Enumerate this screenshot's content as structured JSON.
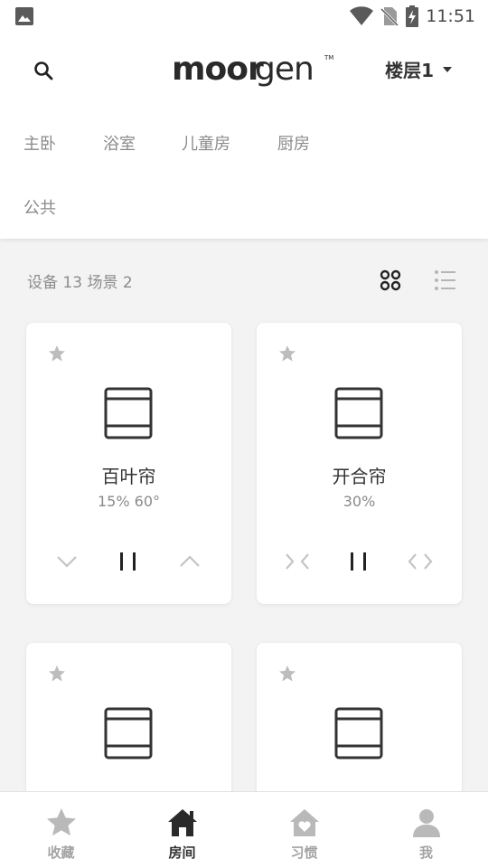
{
  "status_bar": {
    "time": "11:51"
  },
  "header": {
    "logo_text": "moorgen",
    "floor_label": "楼层1"
  },
  "rooms": [
    "主卧",
    "浴室",
    "儿童房",
    "厨房",
    "公共"
  ],
  "summary": {
    "text": "设备 13 场景 2"
  },
  "devices": [
    {
      "name": "百叶帘",
      "value": "15% 60°"
    },
    {
      "name": "开合帘",
      "value": "30%"
    },
    {
      "name": "",
      "value": ""
    },
    {
      "name": "",
      "value": ""
    }
  ],
  "nav": [
    {
      "label": "收藏",
      "icon": "star-icon"
    },
    {
      "label": "房间",
      "icon": "home-icon"
    },
    {
      "label": "习惯",
      "icon": "heart-home-icon"
    },
    {
      "label": "我",
      "icon": "user-icon"
    }
  ],
  "colors": {
    "active": "#333333",
    "inactive": "#a3a3a3",
    "background": "#f3f3f3"
  }
}
